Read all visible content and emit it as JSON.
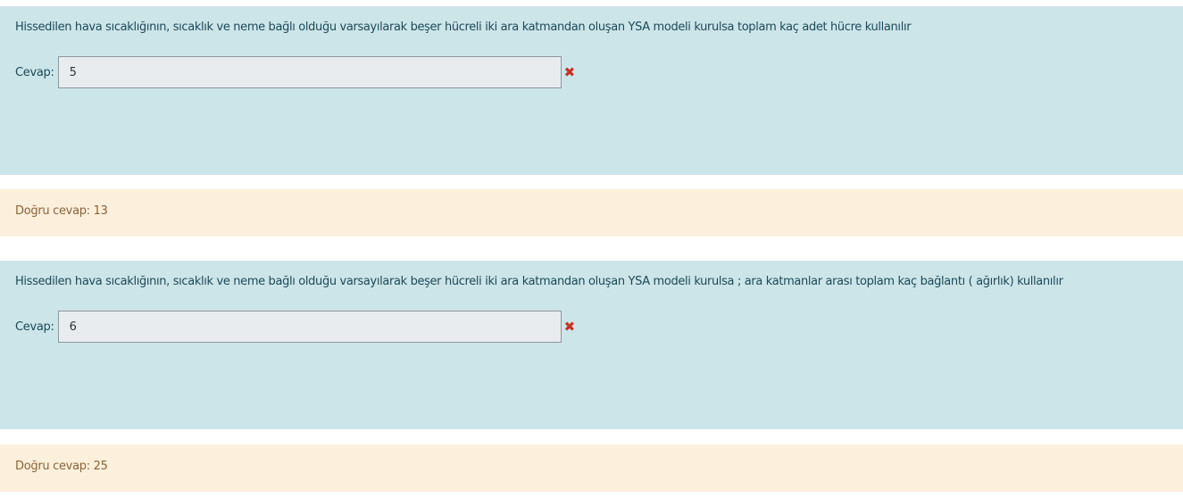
{
  "questions": [
    {
      "text": "Hissedilen hava sıcaklığının, sıcaklık ve neme bağlı olduğu varsayılarak beşer hücreli  iki ara katmandan oluşan YSA modeli kurulsa toplam kaç adet hücre kullanılır",
      "label": "Cevap:",
      "answer": "5",
      "status_icon": "✖",
      "feedback": "Doğru cevap: 13"
    },
    {
      "text": "Hissedilen hava sıcaklığının, sıcaklık ve neme bağlı olduğu varsayılarak beşer hücreli  iki ara katmandan oluşan YSA modeli kurulsa ; ara katmanlar arası toplam kaç bağlantı ( ağırlık) kullanılır",
      "label": "Cevap:",
      "answer": "6",
      "status_icon": "✖",
      "feedback": "Doğru cevap: 25"
    }
  ]
}
